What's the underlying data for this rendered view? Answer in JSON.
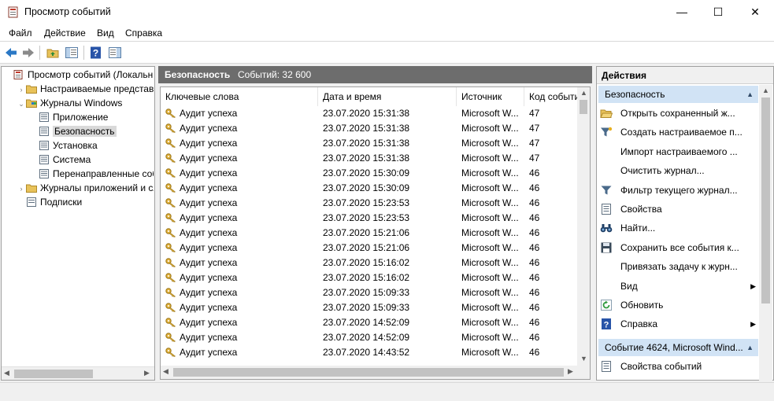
{
  "window": {
    "title": "Просмотр событий",
    "minimize": "—",
    "maximize": "☐",
    "close": "✕"
  },
  "menu": [
    {
      "label": "Файл"
    },
    {
      "label": "Действие"
    },
    {
      "label": "Вид"
    },
    {
      "label": "Справка"
    }
  ],
  "tree": {
    "items": [
      {
        "label": "Просмотр событий (Локальный)",
        "level": 0,
        "expander": "",
        "icon": "event-viewer-icon"
      },
      {
        "label": "Настраиваемые представления",
        "level": 1,
        "expander": "›",
        "icon": "folder-icon"
      },
      {
        "label": "Журналы Windows",
        "level": 1,
        "expander": "⌄",
        "icon": "windows-logs-icon"
      },
      {
        "label": "Приложение",
        "level": 2,
        "expander": "",
        "icon": "log-icon"
      },
      {
        "label": "Безопасность",
        "level": 2,
        "expander": "",
        "icon": "log-icon",
        "selected": true
      },
      {
        "label": "Установка",
        "level": 2,
        "expander": "",
        "icon": "log-icon"
      },
      {
        "label": "Система",
        "level": 2,
        "expander": "",
        "icon": "log-icon"
      },
      {
        "label": "Перенаправленные события",
        "level": 2,
        "expander": "",
        "icon": "log-icon"
      },
      {
        "label": "Журналы приложений и служб",
        "level": 1,
        "expander": "›",
        "icon": "folder-icon"
      },
      {
        "label": "Подписки",
        "level": 1,
        "expander": "",
        "icon": "subscriptions-icon"
      }
    ]
  },
  "center": {
    "title": "Безопасность",
    "count": "Событий: 32 600",
    "columns": [
      "Ключевые слова",
      "Дата и время",
      "Источник",
      "Код события"
    ],
    "rows": [
      {
        "kw": "Аудит успеха",
        "dt": "23.07.2020 15:31:38",
        "src": "Microsoft W...",
        "code": "47"
      },
      {
        "kw": "Аудит успеха",
        "dt": "23.07.2020 15:31:38",
        "src": "Microsoft W...",
        "code": "47"
      },
      {
        "kw": "Аудит успеха",
        "dt": "23.07.2020 15:31:38",
        "src": "Microsoft W...",
        "code": "47"
      },
      {
        "kw": "Аудит успеха",
        "dt": "23.07.2020 15:31:38",
        "src": "Microsoft W...",
        "code": "47"
      },
      {
        "kw": "Аудит успеха",
        "dt": "23.07.2020 15:30:09",
        "src": "Microsoft W...",
        "code": "46"
      },
      {
        "kw": "Аудит успеха",
        "dt": "23.07.2020 15:30:09",
        "src": "Microsoft W...",
        "code": "46"
      },
      {
        "kw": "Аудит успеха",
        "dt": "23.07.2020 15:23:53",
        "src": "Microsoft W...",
        "code": "46"
      },
      {
        "kw": "Аудит успеха",
        "dt": "23.07.2020 15:23:53",
        "src": "Microsoft W...",
        "code": "46"
      },
      {
        "kw": "Аудит успеха",
        "dt": "23.07.2020 15:21:06",
        "src": "Microsoft W...",
        "code": "46"
      },
      {
        "kw": "Аудит успеха",
        "dt": "23.07.2020 15:21:06",
        "src": "Microsoft W...",
        "code": "46"
      },
      {
        "kw": "Аудит успеха",
        "dt": "23.07.2020 15:16:02",
        "src": "Microsoft W...",
        "code": "46"
      },
      {
        "kw": "Аудит успеха",
        "dt": "23.07.2020 15:16:02",
        "src": "Microsoft W...",
        "code": "46"
      },
      {
        "kw": "Аудит успеха",
        "dt": "23.07.2020 15:09:33",
        "src": "Microsoft W...",
        "code": "46"
      },
      {
        "kw": "Аудит успеха",
        "dt": "23.07.2020 15:09:33",
        "src": "Microsoft W...",
        "code": "46"
      },
      {
        "kw": "Аудит успеха",
        "dt": "23.07.2020 14:52:09",
        "src": "Microsoft W...",
        "code": "46"
      },
      {
        "kw": "Аудит успеха",
        "dt": "23.07.2020 14:52:09",
        "src": "Microsoft W...",
        "code": "46"
      },
      {
        "kw": "Аудит успеха",
        "dt": "23.07.2020 14:43:52",
        "src": "Microsoft W...",
        "code": "46"
      }
    ]
  },
  "actions": {
    "title": "Действия",
    "section1": "Безопасность",
    "items1": [
      {
        "label": "Открыть сохраненный ж...",
        "icon": "open-folder-icon",
        "submenu": false
      },
      {
        "label": "Создать настраиваемое п...",
        "icon": "filter-create-icon",
        "submenu": false
      },
      {
        "label": "Импорт настраиваемого ...",
        "icon": "none",
        "submenu": false
      },
      {
        "label": "Очистить журнал...",
        "icon": "none",
        "submenu": false
      },
      {
        "label": "Фильтр текущего журнал...",
        "icon": "filter-icon",
        "submenu": false
      },
      {
        "label": "Свойства",
        "icon": "properties-icon",
        "submenu": false
      },
      {
        "label": "Найти...",
        "icon": "binoculars-icon",
        "submenu": false
      },
      {
        "label": "Сохранить все события к...",
        "icon": "save-icon",
        "submenu": false
      },
      {
        "label": "Привязать задачу к журн...",
        "icon": "none",
        "submenu": false
      },
      {
        "label": "Вид",
        "icon": "none",
        "submenu": true
      },
      {
        "label": "Обновить",
        "icon": "refresh-icon",
        "submenu": false
      },
      {
        "label": "Справка",
        "icon": "help-icon",
        "submenu": true
      }
    ],
    "section2": "Событие 4624, Microsoft Wind...",
    "items2": [
      {
        "label": "Свойства событий",
        "icon": "properties-icon",
        "submenu": false
      }
    ]
  }
}
